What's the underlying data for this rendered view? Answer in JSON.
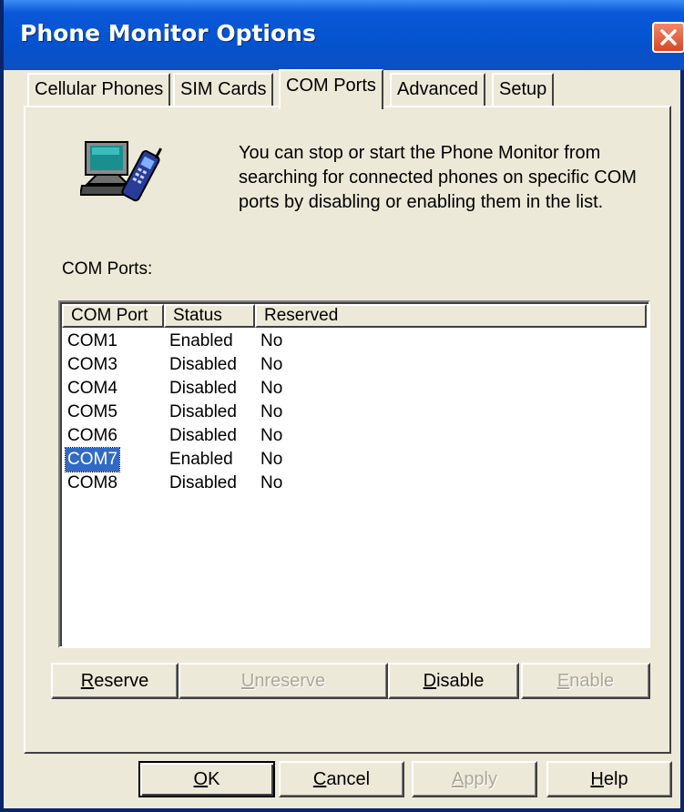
{
  "window": {
    "title": "Phone Monitor Options"
  },
  "tabs": [
    {
      "label": "Cellular Phones",
      "active": false
    },
    {
      "label": "SIM Cards",
      "active": false
    },
    {
      "label": "COM Ports",
      "active": true
    },
    {
      "label": "Advanced",
      "active": false
    },
    {
      "label": "Setup",
      "active": false
    }
  ],
  "description": "You can stop or start the Phone Monitor from searching for connected phones on specific COM ports by disabling or enabling them in the list.",
  "list_label": "COM Ports:",
  "columns": [
    "COM Port",
    "Status",
    "Reserved"
  ],
  "rows": [
    {
      "port": "COM1",
      "status": "Enabled",
      "reserved": "No",
      "selected": false
    },
    {
      "port": "COM3",
      "status": "Disabled",
      "reserved": "No",
      "selected": false
    },
    {
      "port": "COM4",
      "status": "Disabled",
      "reserved": "No",
      "selected": false
    },
    {
      "port": "COM5",
      "status": "Disabled",
      "reserved": "No",
      "selected": false
    },
    {
      "port": "COM6",
      "status": "Disabled",
      "reserved": "No",
      "selected": false
    },
    {
      "port": "COM7",
      "status": "Enabled",
      "reserved": "No",
      "selected": true
    },
    {
      "port": "COM8",
      "status": "Disabled",
      "reserved": "No",
      "selected": false
    }
  ],
  "action_buttons": {
    "reserve": {
      "mnemonic": "R",
      "rest": "eserve",
      "enabled": true
    },
    "unreserve": {
      "mnemonic": "U",
      "rest": "nreserve",
      "enabled": false
    },
    "disable": {
      "mnemonic": "D",
      "rest": "isable",
      "enabled": true
    },
    "enable": {
      "mnemonic": "E",
      "rest": "nable",
      "enabled": false
    }
  },
  "dialog_buttons": {
    "ok": {
      "mnemonic": "O",
      "rest": "K",
      "enabled": true
    },
    "cancel": {
      "mnemonic": "C",
      "rest": "ancel",
      "enabled": true
    },
    "apply": {
      "mnemonic": "A",
      "rest": "pply",
      "enabled": false
    },
    "help": {
      "mnemonic": "H",
      "rest": "elp",
      "enabled": true
    }
  },
  "icons": {
    "app": "computer-phone-icon",
    "close": "close-icon"
  },
  "colors": {
    "titlebar": "#0453cf",
    "selection": "#316ac5",
    "face": "#ece9d8"
  }
}
